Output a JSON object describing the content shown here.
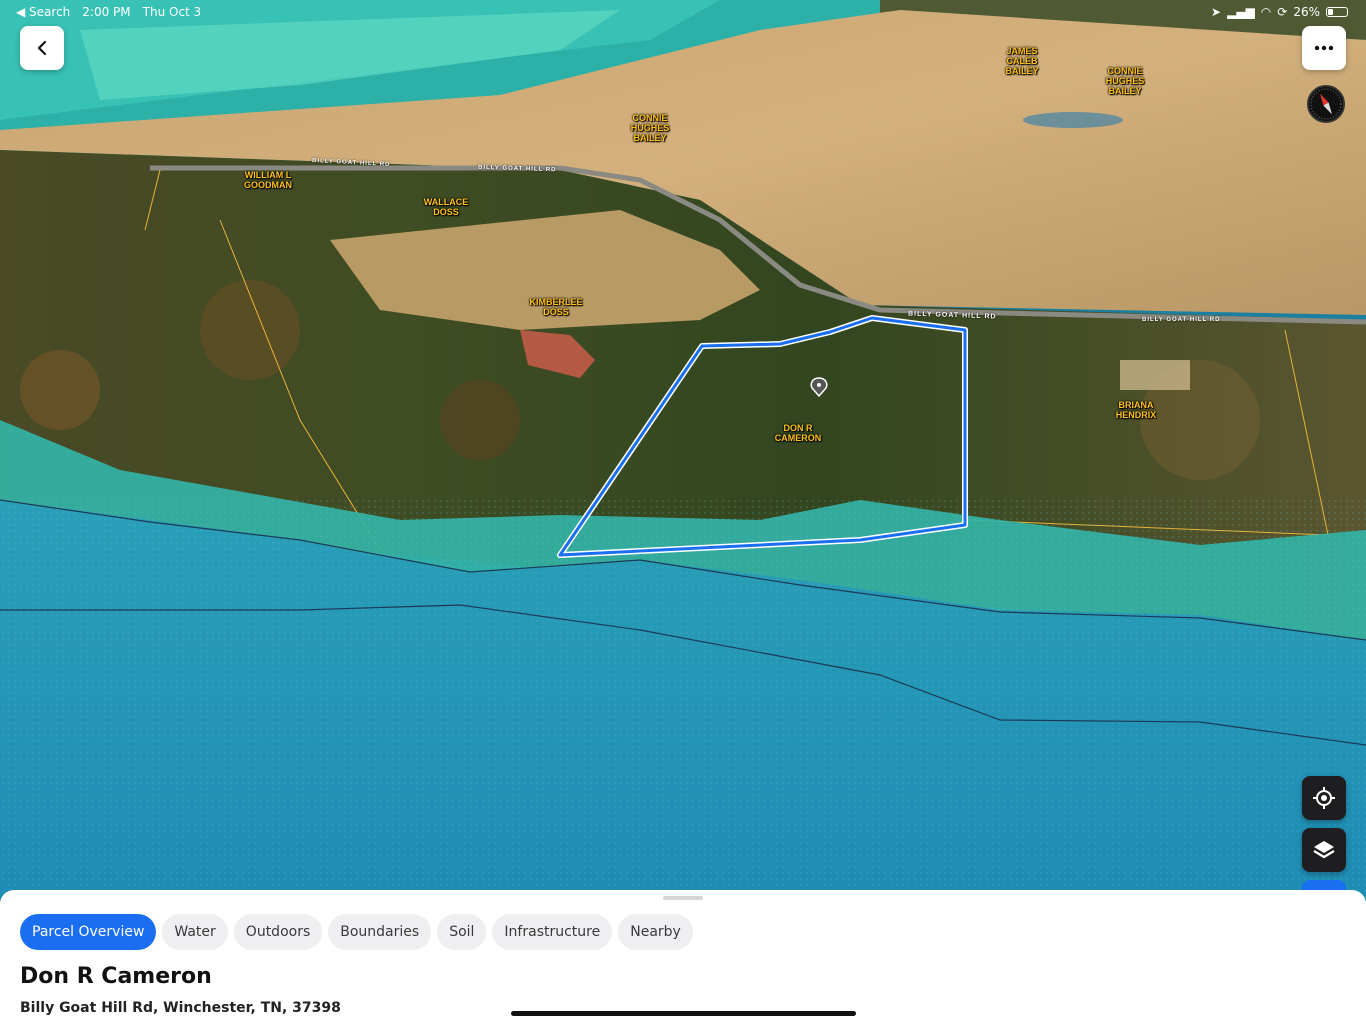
{
  "status_bar": {
    "back_app": "◀ Search",
    "time": "2:00 PM",
    "date": "Thu Oct 3",
    "battery": "26%"
  },
  "map": {
    "owner_labels": [
      {
        "id": "james",
        "text": "JAMES\nCALEB\nBAILEY"
      },
      {
        "id": "connie1",
        "text": "CONNIE\nHUGHES\nBAILEY"
      },
      {
        "id": "connie2",
        "text": "CONNIE\nHUGHES\nBAILEY"
      },
      {
        "id": "william",
        "text": "WILLIAM L\nGOODMAN"
      },
      {
        "id": "wallace",
        "text": "WALLACE\nDOSS"
      },
      {
        "id": "kimberlee",
        "text": "KIMBERLEE\nDOSS"
      },
      {
        "id": "don",
        "text": "DON R\nCAMERON"
      },
      {
        "id": "briana",
        "text": "BRIANA\nHENDRIX"
      }
    ],
    "road_labels": [
      {
        "id": "road1",
        "text": "BILLY GOAT HILL RD"
      },
      {
        "id": "road2",
        "text": "BILLY GOAT HILL RD"
      },
      {
        "id": "road3",
        "text": "BILLY GOAT HILL RD"
      },
      {
        "id": "road4",
        "text": "BILLY GOAT HILL RD"
      }
    ],
    "parcel_outline_color": "#1a6ff0",
    "flood_zone_color": "#2fb5b0",
    "water_color": "#1d88b0"
  },
  "sheet": {
    "tabs": [
      "Parcel Overview",
      "Water",
      "Outdoors",
      "Boundaries",
      "Soil",
      "Infrastructure",
      "Nearby"
    ],
    "active_tab": "Parcel Overview",
    "owner_name": "Don R Cameron",
    "address": "Billy Goat Hill Rd, Winchester, TN, 37398"
  }
}
